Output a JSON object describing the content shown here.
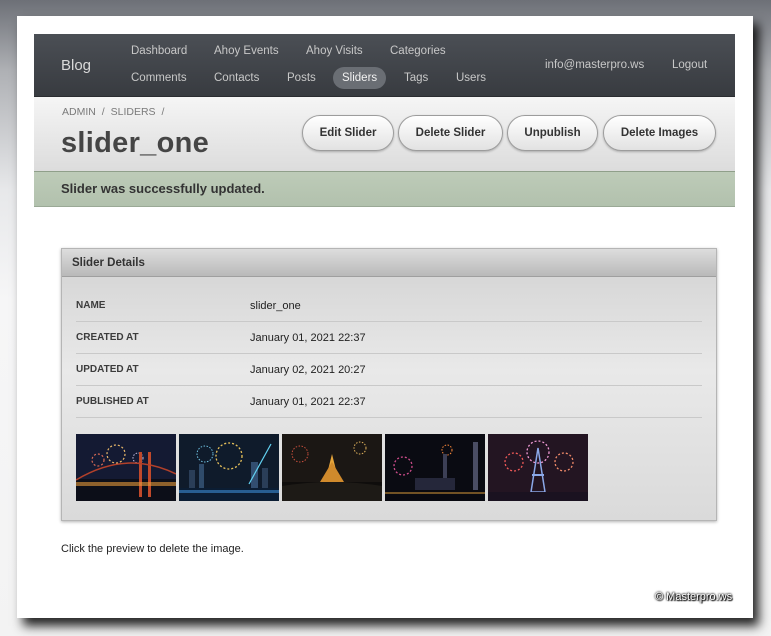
{
  "nav": {
    "brand": "Blog",
    "items": [
      {
        "label": "Dashboard"
      },
      {
        "label": "Ahoy Events"
      },
      {
        "label": "Ahoy Visits"
      },
      {
        "label": "Categories"
      },
      {
        "label": "Comments"
      },
      {
        "label": "Contacts"
      },
      {
        "label": "Posts"
      },
      {
        "label": "Sliders"
      },
      {
        "label": "Tags"
      },
      {
        "label": "Users"
      }
    ],
    "active": "Sliders",
    "email": "info@masterpro.ws",
    "logout": "Logout"
  },
  "breadcrumb": [
    "ADMIN",
    "/",
    "SLIDERS",
    "/"
  ],
  "title": "slider_one",
  "actions": {
    "edit": "Edit Slider",
    "delete": "Delete Slider",
    "unpublish": "Unpublish",
    "delete_images": "Delete Images"
  },
  "flash": "Slider was successfully updated.",
  "details": {
    "heading": "Slider Details",
    "rows": [
      {
        "key": "NAME",
        "value": "slider_one"
      },
      {
        "key": "CREATED AT",
        "value": "January 01, 2021 22:37"
      },
      {
        "key": "UPDATED AT",
        "value": "January 02, 2021 20:27"
      },
      {
        "key": "PUBLISHED AT",
        "value": "January 01, 2021 22:37"
      }
    ],
    "images": [
      {
        "subject": "fireworks over a bridge"
      },
      {
        "subject": "fireworks over city skyline"
      },
      {
        "subject": "fireworks over golden temple"
      },
      {
        "subject": "fireworks over harbor towers"
      },
      {
        "subject": "fireworks over eiffel tower"
      }
    ]
  },
  "hint": "Click the preview to delete the image.",
  "watermark": "© Masterpro.ws",
  "colors": {
    "navbar": "#3f4247",
    "active_pill": "#6a6e74",
    "flash_bg": "#b8c6b3",
    "panel_header": "#c4c4c4"
  }
}
